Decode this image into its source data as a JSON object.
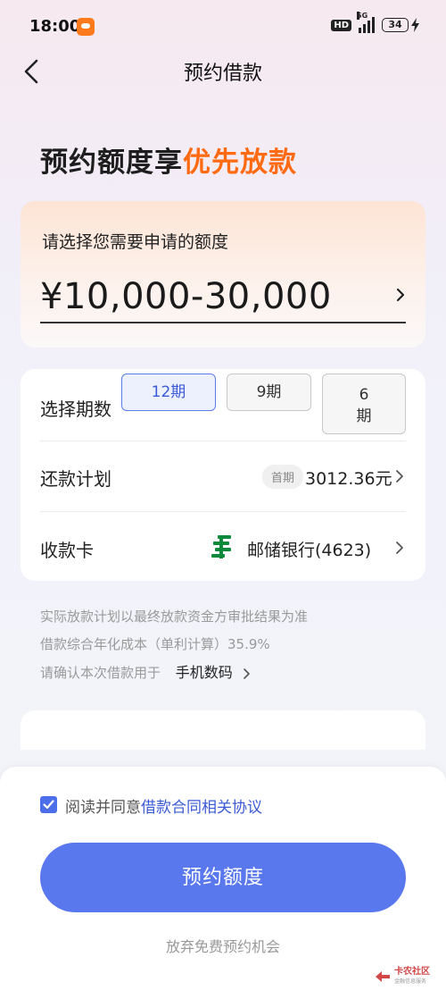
{
  "status_bar": {
    "time": "18:00",
    "hd": "HD",
    "network": "5G",
    "battery": "34",
    "icons": [
      "app-notification-icon",
      "signal-icon",
      "battery-icon",
      "charging-bolt-icon"
    ]
  },
  "nav": {
    "title": "预约借款",
    "back_icon": "back-arrow-icon"
  },
  "headline": {
    "prefix": "预约额度享",
    "accent": "优先放款",
    "accent_color": "#ff6a13"
  },
  "amount_card": {
    "prompt": "请选择您需要申请的额度",
    "value": "¥10,000-30,000"
  },
  "term": {
    "label": "选择期数",
    "options": [
      "12期",
      "9期",
      "6期"
    ],
    "option_6_line1": "6",
    "option_6_line2": "期",
    "selected": "12期"
  },
  "repayment": {
    "label": "还款计划",
    "first_tag": "首期",
    "amount": "3012.36元"
  },
  "card": {
    "label": "收款卡",
    "bank_icon": "postal-savings-bank-logo-icon",
    "bank_name": "邮储银行(4623)",
    "bank_color": "#0a8a3a"
  },
  "notes": {
    "line1": "实际放款计划以最终放款资金方审批结果为准",
    "line2": "借款综合年化成本（单利计算）35.9%",
    "purpose_prefix": "请确认本次借款用于",
    "purpose_value": "手机数码"
  },
  "bottom": {
    "agree_prefix": "阅读并同意",
    "agree_link": "借款合同相关协议",
    "agreed": true,
    "submit_label": "预约额度",
    "abandon_label": "放弃免费预约机会",
    "accent_color": "#5a78ee"
  },
  "watermark": {
    "text": "卡农社区",
    "sub": "金融信息服务"
  }
}
